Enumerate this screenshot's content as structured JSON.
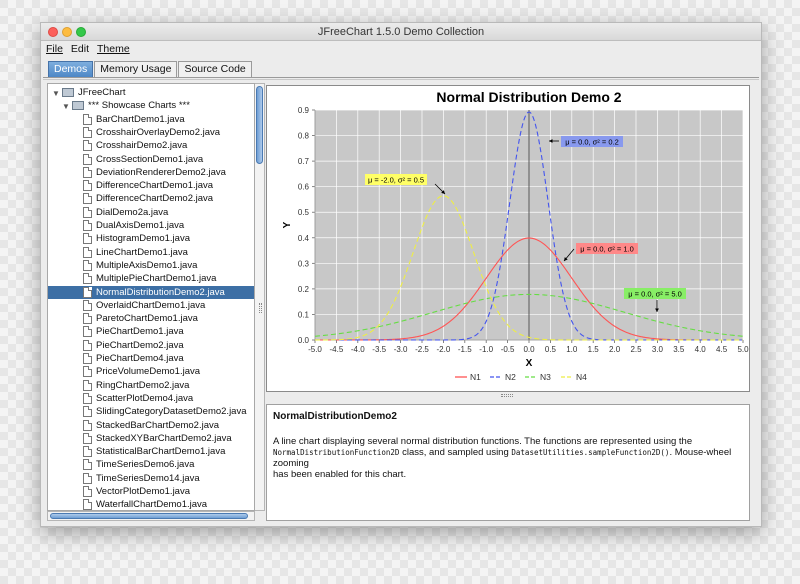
{
  "window": {
    "title": "JFreeChart 1.5.0 Demo Collection"
  },
  "menu": [
    "File",
    "Edit",
    "Theme"
  ],
  "tabs": [
    "Demos",
    "Memory Usage",
    "Source Code"
  ],
  "active_tab": "Demos",
  "tree": {
    "root": "JFreeChart",
    "group": "*** Showcase Charts ***",
    "selected": "NormalDistributionDemo2.java",
    "items": [
      "BarChartDemo1.java",
      "CrosshairOverlayDemo2.java",
      "CrosshairDemo2.java",
      "CrossSectionDemo1.java",
      "DeviationRendererDemo2.java",
      "DifferenceChartDemo1.java",
      "DifferenceChartDemo2.java",
      "DialDemo2a.java",
      "DualAxisDemo1.java",
      "HistogramDemo1.java",
      "LineChartDemo1.java",
      "MultipleAxisDemo1.java",
      "MultiplePieChartDemo1.java",
      "NormalDistributionDemo2.java",
      "OverlaidChartDemo1.java",
      "ParetoChartDemo1.java",
      "PieChartDemo1.java",
      "PieChartDemo2.java",
      "PieChartDemo4.java",
      "PriceVolumeDemo1.java",
      "RingChartDemo2.java",
      "ScatterPlotDemo4.java",
      "SlidingCategoryDatasetDemo2.java",
      "StackedBarChartDemo2.java",
      "StackedXYBarChartDemo2.java",
      "StatisticalBarChartDemo1.java",
      "TimeSeriesDemo6.java",
      "TimeSeriesDemo14.java",
      "VectorPlotDemo1.java",
      "WaterfallChartDemo1.java"
    ]
  },
  "chart_data": {
    "type": "line",
    "title": "Normal Distribution Demo 2",
    "xlabel": "X",
    "ylabel": "Y",
    "xlim": [
      -5.0,
      5.0
    ],
    "ylim": [
      0.0,
      0.9
    ],
    "x_ticks": [
      "-5.0",
      "-4.5",
      "-4.0",
      "-3.5",
      "-3.0",
      "-2.5",
      "-2.0",
      "-1.5",
      "-1.0",
      "-0.5",
      "0.0",
      "0.5",
      "1.0",
      "1.5",
      "2.0",
      "2.5",
      "3.0",
      "3.5",
      "4.0",
      "4.5",
      "5.0"
    ],
    "y_ticks": [
      "0.0",
      "0.1",
      "0.2",
      "0.3",
      "0.4",
      "0.5",
      "0.6",
      "0.7",
      "0.8",
      "0.9"
    ],
    "grid": true,
    "legend_position": "bottom",
    "series": [
      {
        "name": "N1",
        "mean": 0.0,
        "variance": 1.0,
        "color": "#ff5555",
        "dash": false
      },
      {
        "name": "N2",
        "mean": 0.0,
        "variance": 0.2,
        "color": "#4455ee",
        "dash": true
      },
      {
        "name": "N3",
        "mean": 0.0,
        "variance": 5.0,
        "color": "#66dd44",
        "dash": true
      },
      {
        "name": "N4",
        "mean": -2.0,
        "variance": 0.5,
        "color": "#eeee44",
        "dash": true
      }
    ],
    "annotations": [
      {
        "text": "μ = 0.0, σ² = 0.2",
        "x": 0.0,
        "y": 0.892,
        "bg": "#8899ee",
        "arrow": "left"
      },
      {
        "text": "μ = -2.0, σ² = 0.5",
        "x": -2.0,
        "y": 0.564,
        "bg": "#ffff66",
        "arrow": "right"
      },
      {
        "text": "μ = 0.0, σ² = 1.0",
        "x": 0.9,
        "y": 0.266,
        "bg": "#ff8888",
        "arrow": "left"
      },
      {
        "text": "μ = 0.0, σ² = 5.0",
        "x": 3.0,
        "y": 0.073,
        "bg": "#88ee66",
        "arrow": "down"
      }
    ]
  },
  "description": {
    "title": "NormalDistributionDemo2",
    "body_1": "A line chart displaying several normal distribution functions. The functions are represented using the",
    "code_1": "NormalDistributionFunction2D",
    "body_2": " class, and sampled using ",
    "code_2": "DatasetUtilities.sampleFunction2D()",
    "body_3": ". Mouse-wheel zooming",
    "body_4": "has been enabled for this chart."
  }
}
